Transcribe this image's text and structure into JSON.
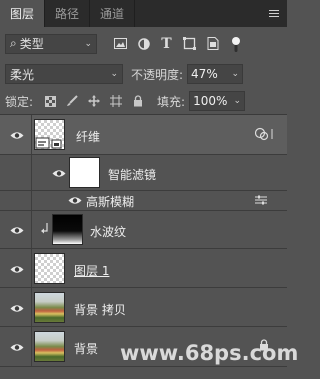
{
  "tabs": [
    {
      "label": "图层"
    },
    {
      "label": "路径"
    },
    {
      "label": "通道"
    }
  ],
  "filter": {
    "kind_label": "类型"
  },
  "blend": {
    "mode": "柔光"
  },
  "opacity": {
    "label": "不透明度:",
    "value": "47%"
  },
  "lock": {
    "label": "锁定:"
  },
  "fill": {
    "label": "填充:",
    "value": "100%"
  },
  "layers": [
    {
      "name": "纤维",
      "selected": true,
      "smart_object": true
    },
    {
      "name": "智能滤镜"
    },
    {
      "name": "高斯模糊"
    },
    {
      "name": "水波纹",
      "clipped": true
    },
    {
      "name": "图层 1"
    },
    {
      "name": "背景 拷贝"
    },
    {
      "name": "背景",
      "locked": true
    }
  ],
  "watermark": "www.68ps.com",
  "colors": {
    "panel_bg": "#535353",
    "tabbar_bg": "#2b2b2b",
    "selected_row": "#5e5e5e"
  }
}
